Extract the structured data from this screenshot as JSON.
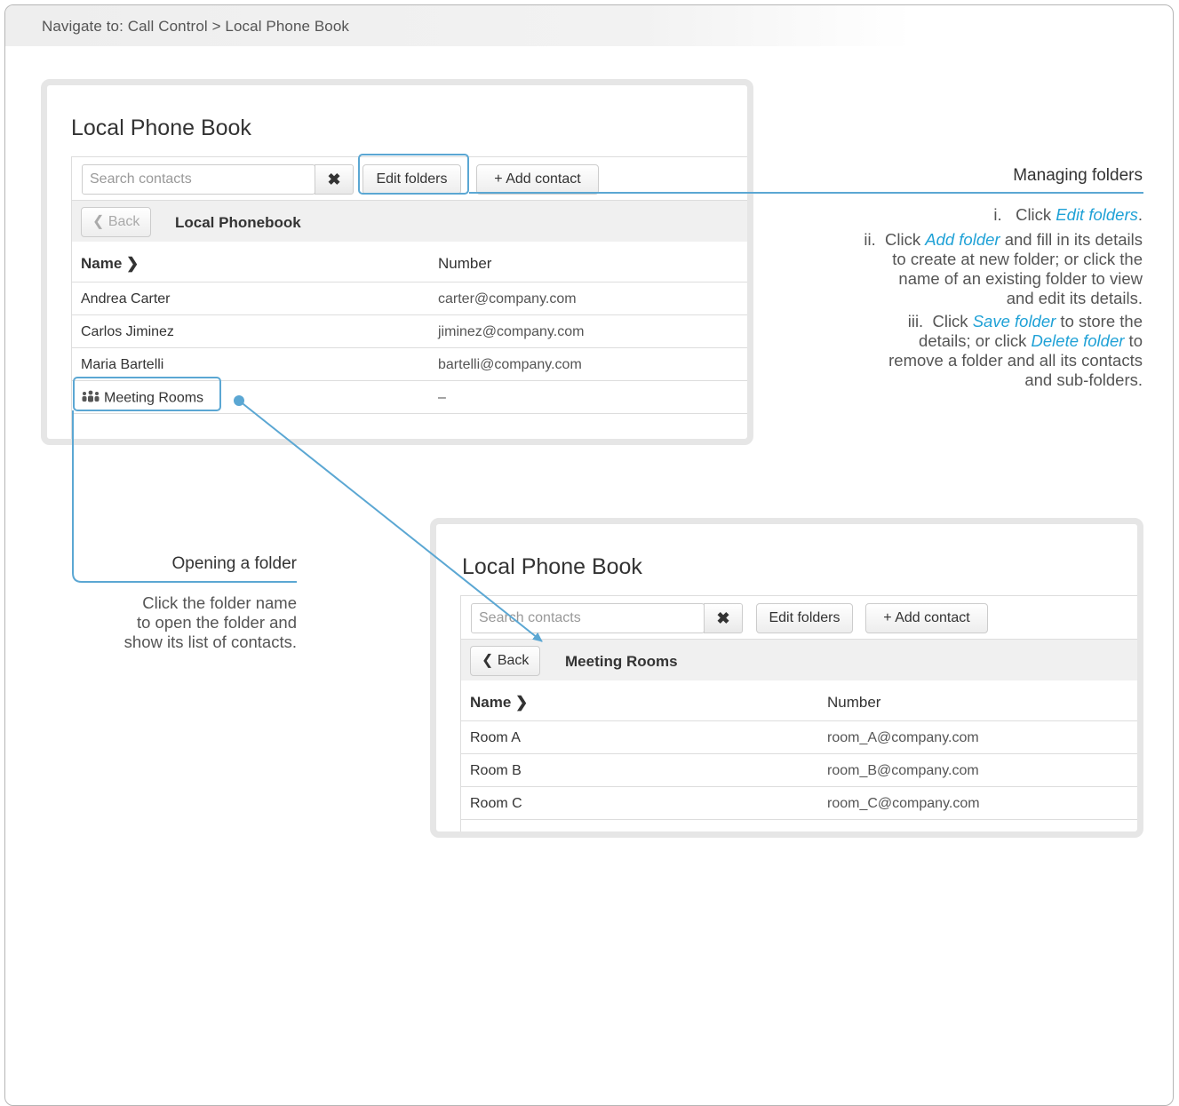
{
  "nav": {
    "text": "Navigate to: Call Control > Local Phone Book"
  },
  "shot1": {
    "title": "Local Phone Book",
    "search_placeholder": "Search contacts",
    "clear_glyph": "✖",
    "edit_folders_label": "Edit folders",
    "add_contact_label": "+ Add contact",
    "back_label": "❮ Back",
    "crumb": "Local Phonebook",
    "col_name": "Name ❯",
    "col_number": "Number",
    "rows": [
      {
        "name": "Andrea Carter",
        "number": "carter@company.com"
      },
      {
        "name": "Carlos Jiminez",
        "number": "jiminez@company.com"
      },
      {
        "name": "Maria Bartelli",
        "number": "bartelli@company.com"
      },
      {
        "name": "Meeting Rooms",
        "number": "–"
      }
    ]
  },
  "shot2": {
    "title": "Local Phone Book",
    "search_placeholder": "Search contacts",
    "clear_glyph": "✖",
    "edit_folders_label": "Edit folders",
    "add_contact_label": "+ Add contact",
    "back_label": "❮ Back",
    "crumb": "Meeting Rooms",
    "col_name": "Name ❯",
    "col_number": "Number",
    "rows": [
      {
        "name": "Room A",
        "number": "room_A@company.com"
      },
      {
        "name": "Room B",
        "number": "room_B@company.com"
      },
      {
        "name": "Room C",
        "number": "room_C@company.com"
      }
    ]
  },
  "managing": {
    "title": "Managing folders",
    "step1": {
      "prefix": "i.   Click ",
      "link": "Edit folders",
      "suffix": "."
    },
    "step2": {
      "prefix": "ii.  Click ",
      "link": "Add folder",
      "line1_rest": " and fill in its details",
      "line2": "to create at new folder; or click the",
      "line3": "name of an existing folder to view",
      "line4": "and edit its details."
    },
    "step3": {
      "prefix": "iii.  Click ",
      "link": "Save folder",
      "line1_rest": " to store the",
      "line2_prefix": "details; or click ",
      "link2": "Delete folder",
      "line2_rest": " to",
      "line3": "remove a folder and all its contacts",
      "line4": "and sub-folders."
    }
  },
  "opening": {
    "title": "Opening a folder",
    "line1": "Click the folder name",
    "line2": "to open the folder and",
    "line3": "show its list of contacts."
  },
  "colors": {
    "accent": "#5ba7d3",
    "link": "#1fa1d6",
    "frame": "#e6e6e6"
  }
}
